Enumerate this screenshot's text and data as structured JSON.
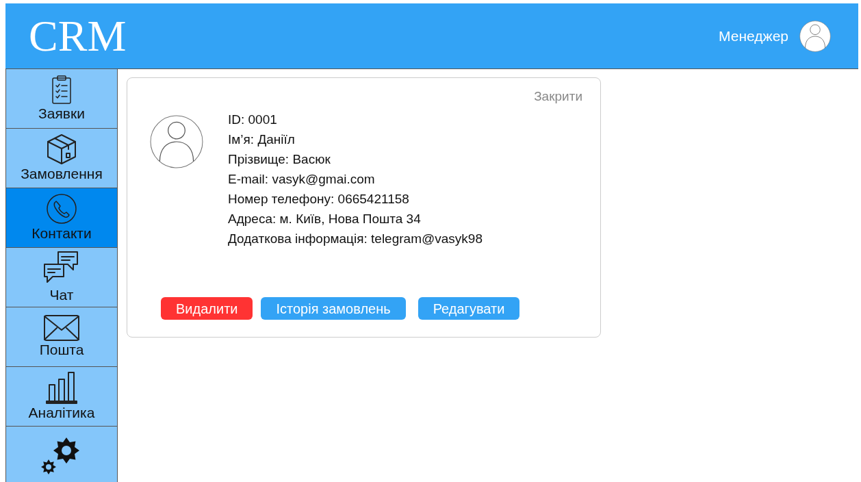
{
  "header": {
    "logo": "CRM",
    "user": "Менеджер"
  },
  "sidebar": {
    "items": [
      {
        "kind": "clipboard",
        "label": "Заявки",
        "selected": false
      },
      {
        "kind": "box",
        "label": "Замовлення",
        "selected": false
      },
      {
        "kind": "phone",
        "label": "Контакти",
        "selected": true
      },
      {
        "kind": "chat",
        "label": "Чат",
        "selected": false
      },
      {
        "kind": "mail",
        "label": "Пошта",
        "selected": false
      },
      {
        "kind": "chart",
        "label": "Аналітика",
        "selected": false
      },
      {
        "kind": "gear",
        "selected": false
      }
    ]
  },
  "card": {
    "close": "Закрити",
    "fields": [
      "ID: 0001",
      "Ім’я: Даніїл",
      "Прізвище: Васюк",
      "E-mail: vasyk@gmai.com",
      "Номер телефону: 0665421158",
      "Адреса: м. Київ, Нова Пошта 34",
      "Додаткова інформація: telegram@vasyk98"
    ],
    "buttons": [
      {
        "kind": "danger",
        "label": "Видалити"
      },
      {
        "kind": "primary",
        "label": "Історія замовлень"
      },
      {
        "kind": "primary",
        "label": "Редагувати"
      }
    ]
  }
}
